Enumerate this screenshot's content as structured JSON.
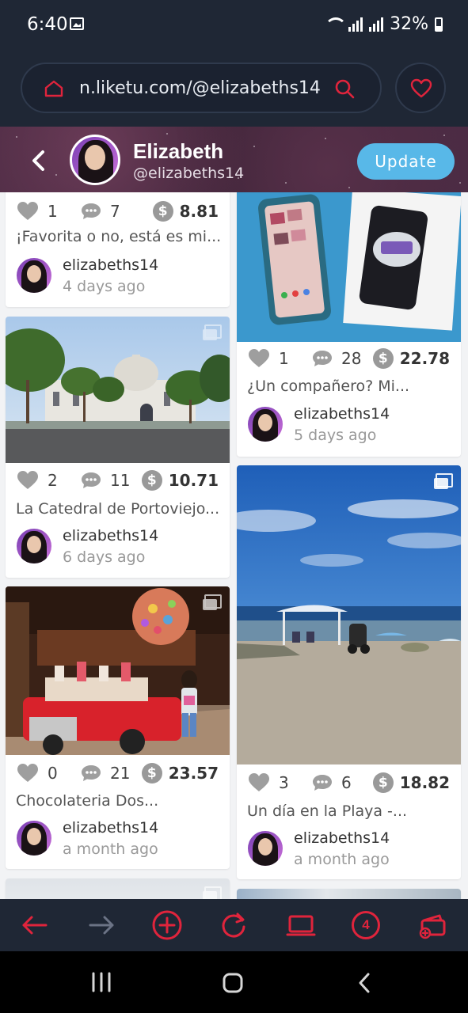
{
  "status_bar": {
    "time": "6:40",
    "battery": "32%"
  },
  "browser": {
    "url": "n.liketu.com/@elizabeths14",
    "tab_count": "4",
    "accent_color": "#e0243c"
  },
  "profile": {
    "name": "Elizabeth",
    "handle": "@elizabeths14",
    "update_label": "Update"
  },
  "posts": [
    {
      "likes": "1",
      "comments": "7",
      "earnings": "8.81",
      "title": "¡Favorita o no, está es mi...",
      "author": "elizabeths14",
      "time": "4 days ago",
      "image": "none"
    },
    {
      "likes": "2",
      "comments": "11",
      "earnings": "10.71",
      "title": "La Catedral de Portoviejo...",
      "author": "elizabeths14",
      "time": "6 days ago",
      "image": "cathedral"
    },
    {
      "likes": "0",
      "comments": "21",
      "earnings": "23.57",
      "title": "Chocolateria Dos...",
      "author": "elizabeths14",
      "time": "a month ago",
      "image": "chocolate-shop"
    },
    {
      "likes": "1",
      "comments": "28",
      "earnings": "22.78",
      "title": "¿Un compañero? Mi...",
      "author": "elizabeths14",
      "time": "5 days ago",
      "image": "phone-box"
    },
    {
      "likes": "3",
      "comments": "6",
      "earnings": "18.82",
      "title": "Un día en la Playa -...",
      "author": "elizabeths14",
      "time": "a month ago",
      "image": "beach"
    }
  ]
}
